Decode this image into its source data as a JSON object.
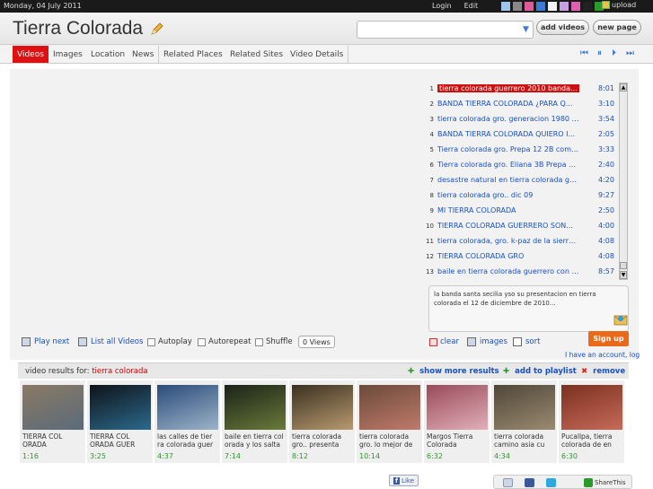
{
  "topbar": {
    "date": "Monday, 04 July 2011",
    "login": "Login",
    "edit": "Edit",
    "upload": "upload",
    "swatches": [
      "#1a1a1a",
      "#9ec4ef",
      "#888888",
      "#e05a9a",
      "#3a7bd5",
      "#f2f2f2",
      "#c6a0e0",
      "#e060b0",
      "#222222",
      "#2a9a2a"
    ]
  },
  "header": {
    "title": "Tierra Colorada",
    "search": {
      "placeholder": ""
    },
    "add_videos": "add videos",
    "new_page": "new page"
  },
  "tabs": [
    "Videos",
    "Images",
    "Location",
    "News",
    "Related Places",
    "Related Sites",
    "Video Details"
  ],
  "transport": [
    "⏮",
    "⏸",
    "⏵",
    "⏭"
  ],
  "playlist": [
    {
      "n": "1",
      "title": "tierra colorada guerrero 2010 banda sa...",
      "dur": "8:01"
    },
    {
      "n": "2",
      "title": "BANDA TIERRA COLORADA ¿PARA Q...",
      "dur": "3:10"
    },
    {
      "n": "3",
      "title": "tierra colorada gro. generacion 1980 19...",
      "dur": "3:54"
    },
    {
      "n": "4",
      "title": "BANDA TIERRA COLORADA QUIERO I...",
      "dur": "2:05"
    },
    {
      "n": "5",
      "title": "Tierra colorada gro. Prepa 12 2B como ...",
      "dur": "3:33"
    },
    {
      "n": "6",
      "title": "Tierra colorada gro. Eliana 3B Prepa 12...",
      "dur": "2:40"
    },
    {
      "n": "7",
      "title": "desastre natural en tierra colorada gro....",
      "dur": "4:20"
    },
    {
      "n": "8",
      "title": "tierra colorada gro.. dic 09",
      "dur": "9:27"
    },
    {
      "n": "9",
      "title": "MI TIERRA COLORADA",
      "dur": "2:50"
    },
    {
      "n": "10",
      "title": "TIERRA COLORADA GUERRERO SON...",
      "dur": "4:00"
    },
    {
      "n": "11",
      "title": "tierra colorada, gro. k-paz de la sierra 2...",
      "dur": "4:08"
    },
    {
      "n": "12",
      "title": "TIERRA COLORADA GRO",
      "dur": "4:08"
    },
    {
      "n": "13",
      "title": "baile en tierra colorada guerrero con lo...",
      "dur": "8:57"
    }
  ],
  "description": "la banda santa secilia yso su presentacion en tierra colorada el 12 de diciembre de 2010...",
  "controls": {
    "play_next": "Play next",
    "list_all": "List all Videos",
    "autoplay": "Autoplay",
    "autorepeat": "Autorepeat",
    "shuffle": "Shuffle",
    "views": "0 Views",
    "clear": "clear",
    "images": "images",
    "sort": "sort"
  },
  "signup": "Sign up",
  "have_account": "I have an account, log",
  "results": {
    "label": "video results for:",
    "query": "tierra colorada",
    "show_more": "show more results",
    "add_playlist": "add to playlist",
    "remove": "remove"
  },
  "thumbs": [
    {
      "caption": "TIERRA COL ORADA",
      "dur": "1:16",
      "colors": [
        "#8a7a64",
        "#5b6b7a"
      ]
    },
    {
      "caption": "TIERRA COL ORADA GUER",
      "dur": "3:25",
      "colors": [
        "#10131a",
        "#2b6a8c"
      ]
    },
    {
      "caption": "las calles de tier ra colorada guer",
      "dur": "4:37",
      "colors": [
        "#2a4b7a",
        "#9db3c8"
      ]
    },
    {
      "caption": "baile en tierra col orada y los salta",
      "dur": "7:14",
      "colors": [
        "#1b2218",
        "#6a7a3a"
      ]
    },
    {
      "caption": "tierra colorada gro.. presenta",
      "dur": "8:12",
      "colors": [
        "#3a3020",
        "#b89a70"
      ]
    },
    {
      "caption": "tierra colorada gro. lo mejor de",
      "dur": "10:14",
      "colors": [
        "#6b4a3a",
        "#c07a6a"
      ]
    },
    {
      "caption": "Margos Tierra Colorada",
      "dur": "6:32",
      "colors": [
        "#9a4a5a",
        "#e0b0b8"
      ]
    },
    {
      "caption": "tierra colorada camino asia cu",
      "dur": "4:34",
      "colors": [
        "#50473a",
        "#9a8a70"
      ]
    },
    {
      "caption": "Pucallpa, tierra colorada de en",
      "dur": "6:30",
      "colors": [
        "#7a3020",
        "#c86a5a"
      ]
    }
  ],
  "footer": {
    "like": "Like",
    "share": "ShareThis"
  }
}
